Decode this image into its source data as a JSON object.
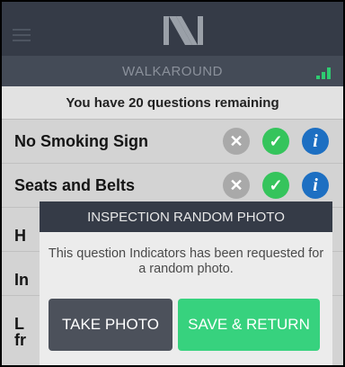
{
  "app": {
    "subtitle": "WALKAROUND",
    "remaining_text": "You have 20 questions remaining"
  },
  "questions": [
    {
      "label": "No Smoking Sign",
      "status": "approved"
    },
    {
      "label": "Seats and Belts",
      "status": "approved"
    }
  ],
  "behind_modal": [
    "H",
    "In",
    "L",
    "fr"
  ],
  "modal": {
    "title": "INSPECTION RANDOM PHOTO",
    "message": "This question Indicators has been requested for a random photo.",
    "take_photo_label": "TAKE PHOTO",
    "save_return_label": "SAVE & RETURN"
  },
  "colors": {
    "topbar": "#353b47",
    "subbar": "#444b57",
    "approve": "#35c45c",
    "info": "#1d6fc2",
    "reject": "#a9a9a9",
    "save_button": "#37d27e",
    "take_button": "#4c515b"
  },
  "icons": {
    "menu": "hamburger-menu-icon",
    "logo": "n-logo",
    "signal": "signal-strength-icon",
    "reject": "x-circle-icon",
    "approve": "check-circle-icon",
    "info": "info-circle-icon"
  }
}
